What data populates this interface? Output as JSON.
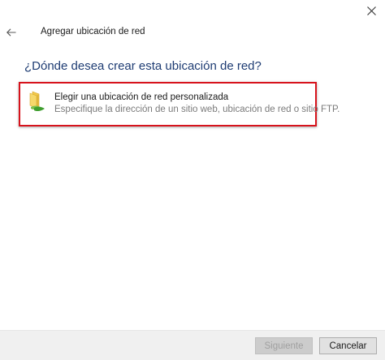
{
  "window": {
    "title": "Agregar ubicación de red",
    "back_icon": "back-arrow-icon",
    "close_icon": "close-icon"
  },
  "main": {
    "heading": "¿Dónde desea crear esta ubicación de red?",
    "option": {
      "icon": "network-folder-icon",
      "title": "Elegir una ubicación de red personalizada",
      "description": "Especifique la dirección de un sitio web, ubicación de red o sitio FTP.",
      "highlight_color": "#d7131c"
    }
  },
  "footer": {
    "next_label": "Siguiente",
    "cancel_label": "Cancelar"
  },
  "colors": {
    "heading": "#1e3c73",
    "footer_bg": "#f0f0f0"
  }
}
